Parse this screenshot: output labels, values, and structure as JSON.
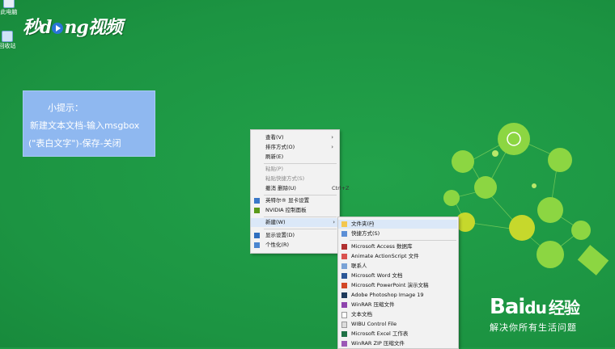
{
  "desktop_icons": [
    {
      "label": "此电脑"
    },
    {
      "label": "回收站"
    }
  ],
  "watermark": {
    "left": "秒",
    "mid": "ng",
    "right": "视频",
    "prefix_letter": "d"
  },
  "tip": {
    "title": "小提示：",
    "line1": "新建文本文档-输入msgbox",
    "line2": "(\"表白文字\")-保存-关闭"
  },
  "context_menu": {
    "items": [
      {
        "label": "查看(V)",
        "submenu": true
      },
      {
        "label": "排序方式(O)",
        "submenu": true
      },
      {
        "label": "刷新(E)"
      },
      {
        "label": "粘贴(P)",
        "disabled": true
      },
      {
        "label": "粘贴快捷方式(S)",
        "disabled": true
      },
      {
        "label": "撤消 删除(U)",
        "shortcut": "Ctrl+Z"
      },
      {
        "label": "英特尔® 显卡设置",
        "icon": "intel-graphics-icon"
      },
      {
        "label": "NVIDIA 控制面板",
        "icon": "nvidia-icon"
      },
      {
        "label": "新建(W)",
        "submenu": true
      },
      {
        "label": "显示设置(D)",
        "icon": "display-settings-icon"
      },
      {
        "label": "个性化(R)",
        "icon": "personalize-icon"
      }
    ]
  },
  "new_submenu": {
    "items": [
      {
        "label": "文件夹(F)",
        "icon": "folder-icon"
      },
      {
        "label": "快捷方式(S)",
        "icon": "shortcut-icon"
      },
      {
        "label": "Microsoft Access 数据库",
        "icon": "access-icon"
      },
      {
        "label": "Animate ActionScript 文件",
        "icon": "actionscript-icon"
      },
      {
        "label": "联系人",
        "icon": "contact-icon"
      },
      {
        "label": "Microsoft Word 文档",
        "icon": "word-icon"
      },
      {
        "label": "Microsoft PowerPoint 演示文稿",
        "icon": "powerpoint-icon"
      },
      {
        "label": "Adobe Photoshop Image 19",
        "icon": "photoshop-icon"
      },
      {
        "label": "WinRAR 压缩文件",
        "icon": "winrar-icon"
      },
      {
        "label": "文本文档",
        "icon": "text-document-icon"
      },
      {
        "label": "WIBU Control File",
        "icon": "wibu-icon"
      },
      {
        "label": "Microsoft Excel 工作表",
        "icon": "excel-icon"
      },
      {
        "label": "WinRAR ZIP 压缩文件",
        "icon": "winrar-zip-icon"
      }
    ]
  },
  "baidu": {
    "logo": "Bai",
    "logo2": "经验",
    "slogan": "解决你所有生活问题"
  },
  "colors": {
    "desktop": "#1f9a45",
    "tip_box": "#8fb8f0",
    "menu_bg": "#f2f2f2",
    "highlight": "#dbe8f8"
  }
}
